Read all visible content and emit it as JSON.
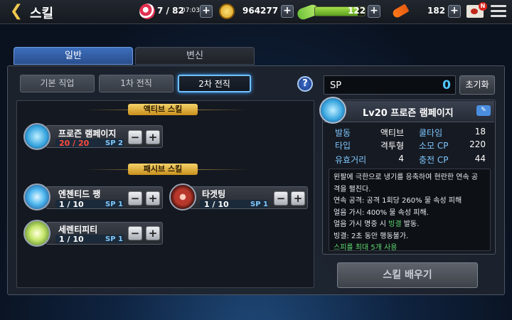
{
  "header": {
    "back": "❮",
    "title": "스킬",
    "ticket": {
      "value": "7 / 82",
      "timer": "07:03"
    },
    "gold": "964277",
    "stamina": {
      "value": "122",
      "fill": 0.85
    },
    "carrot": "182",
    "mail_badge": "N",
    "plus": "+"
  },
  "main_tabs": [
    {
      "label": "일반",
      "active": true
    },
    {
      "label": "변신",
      "active": false
    }
  ],
  "sub_tabs": [
    {
      "label": "기본 직업",
      "active": false
    },
    {
      "label": "1차 전직",
      "active": false
    },
    {
      "label": "2차 전직",
      "active": true
    }
  ],
  "help": "?",
  "sections": {
    "active": "액티브 스킬",
    "passive": "패시브 스킬"
  },
  "skills": [
    {
      "name": "프로즌 램페이지",
      "level": "20 / 20",
      "sp": "SP 2",
      "level_color": "#ff4a3a",
      "maxed": true
    },
    {
      "name": "엔첸티드 팽",
      "level": "1 / 10",
      "sp": "SP 1",
      "level_color": "#ffffff",
      "maxed": false
    },
    {
      "name": "타겟팅",
      "level": "1 / 10",
      "sp": "SP 1",
      "level_color": "#ffffff",
      "maxed": false
    },
    {
      "name": "세렌티피티",
      "level": "1 / 10",
      "sp": "SP 1",
      "level_color": "#ffffff",
      "maxed": false
    }
  ],
  "stepper": {
    "minus": "−",
    "plus": "+"
  },
  "sp_panel": {
    "label": "SP",
    "value": "0",
    "reset": "초기화"
  },
  "detail": {
    "title": "Lv20 프로즌 램페이지",
    "stats": [
      {
        "k": "발동",
        "v": "액티브",
        "k2": "쿨타임",
        "v2": "18"
      },
      {
        "k": "타입",
        "v": "격투형",
        "k2": "소모 CP",
        "v2": "220"
      },
      {
        "k": "유효거리",
        "v": "4",
        "k2": "충전 CP",
        "v2": "44"
      }
    ],
    "desc": [
      "왼팔에 극한으로 냉기를 응축하여 현란한 연속 공",
      "격을 펼친다.",
      "연속 공격: 공격 1회당 260% 물 속성 피해",
      "얼음 가시: 400% 물 속성 피해.",
      "얼음 가시 명중 시 빙결 발동.",
      "빙결: 2초 동안 행동불가.",
      "스피를 최대 5개 사용"
    ],
    "desc_em": "빙결",
    "learn": "스킬 배우기"
  }
}
